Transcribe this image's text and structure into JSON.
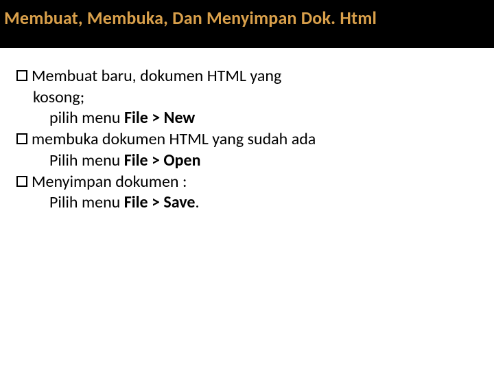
{
  "title": "Membuat, Membuka, Dan Menyimpan Dok. Html",
  "items": [
    {
      "text_a": "Membuat baru, dokumen HTML yang",
      "text_b": "kosong;",
      "sub_prefix": "pilih menu ",
      "sub_bold": "File > New"
    },
    {
      "text_a": "membuka dokumen HTML yang sudah ada",
      "sub_prefix": "Pilih menu ",
      "sub_bold": "File > Open"
    },
    {
      "text_a": "Menyimpan dokumen :",
      "sub_prefix": "Pilih menu ",
      "sub_bold": "File > Save",
      "sub_tail": "."
    }
  ]
}
